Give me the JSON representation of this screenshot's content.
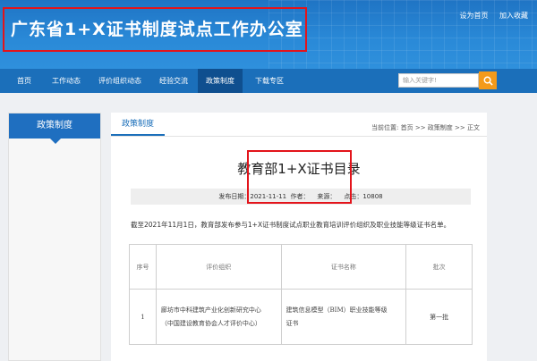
{
  "header": {
    "site_title": "广东省1+X证书制度试点工作办公室",
    "top_links": [
      "设为首页",
      "加入收藏"
    ]
  },
  "nav": {
    "items": [
      "首页",
      "工作动态",
      "评价组织动态",
      "经验交流",
      "政策制度",
      "下载专区"
    ],
    "active_index": 4,
    "search_placeholder": "输入关键字!"
  },
  "sidebar": {
    "heading": "政策制度"
  },
  "main": {
    "tab": "政策制度",
    "breadcrumb": "当前位置: 首页 >> 政策制度 >> 正文",
    "article_title": "教育部1+X证书目录",
    "meta": {
      "date_label": "发布日期：",
      "date": "2021-11-11",
      "author_label": "作者：",
      "source_label": "来源：",
      "hits_label": "点击：",
      "hits": "10808"
    },
    "intro": "截至2021年11月1日，教育部发布参与1+X证书制度试点职业教育培训评价组织及职业技能等级证书名单。",
    "table": {
      "headers": [
        "序号",
        "评价组织",
        "证书名称",
        "批次"
      ],
      "rows": [
        {
          "no": "1",
          "org_line1": "廊坊市中科建筑产业化创新研究中心",
          "org_line2": "（中国建设教育协会人才评价中心）",
          "cert_line1": "建筑信息模型（BIM）职业技能等级",
          "cert_line2": "证书",
          "batch": "第一批"
        }
      ]
    }
  },
  "colors": {
    "header_blue": "#2a8ad8",
    "nav_blue": "#1b6fba",
    "nav_active": "#0f4f8f",
    "highlight_red": "#e3141b",
    "search_orange": "#f39a1b"
  }
}
